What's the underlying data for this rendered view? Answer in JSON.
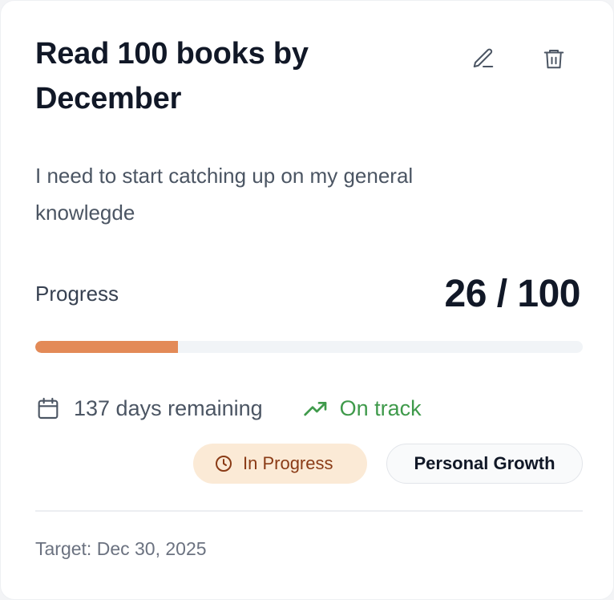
{
  "goal": {
    "title": "Read 100 books by December",
    "description": "I need to start catching up on my general knowlegde"
  },
  "actions": {
    "edit_icon": "pencil-icon",
    "delete_icon": "trash-icon"
  },
  "progress": {
    "label": "Progress",
    "value_text": "26 / 100",
    "current": 26,
    "total": 100,
    "fill_color": "#e38a57",
    "track_color": "#f1f4f7"
  },
  "meta": {
    "days_remaining": "137 days remaining",
    "days_icon": "calendar-icon",
    "status": "On track",
    "status_icon": "trending-up-icon",
    "status_color": "#3f9a4b"
  },
  "badges": {
    "state": "In Progress",
    "state_icon": "clock-icon",
    "category": "Personal Growth"
  },
  "footer": {
    "target": "Target: Dec 30, 2025"
  }
}
